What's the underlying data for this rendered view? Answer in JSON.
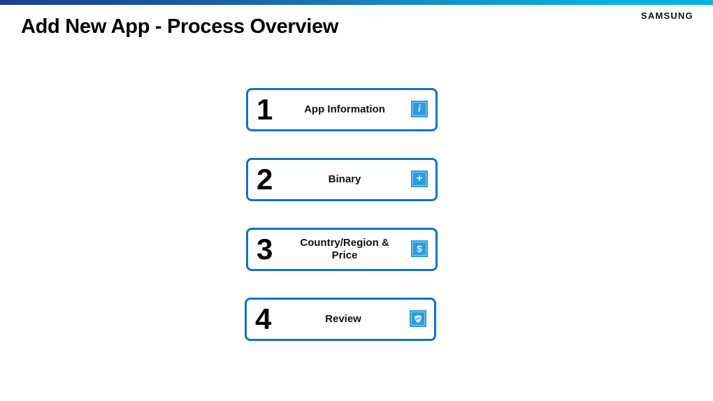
{
  "header": {
    "title": "Add New App - Process Overview",
    "brand": "SAMSUNG",
    "accent_gradient": [
      "#1b3f8b",
      "#04b5de"
    ]
  },
  "steps": [
    {
      "number": "1",
      "label": "App Information",
      "icon": "info-icon",
      "glyph": "i"
    },
    {
      "number": "2",
      "label": "Binary",
      "icon": "plus-icon",
      "glyph": "+"
    },
    {
      "number": "3",
      "label": "Country/Region & Price",
      "icon": "dollar-icon",
      "glyph": "$"
    },
    {
      "number": "4",
      "label": "Review",
      "icon": "shield-icon",
      "glyph": ""
    }
  ],
  "colors": {
    "step_border": "#1571c4",
    "icon_bg": "#2d9bd9"
  }
}
